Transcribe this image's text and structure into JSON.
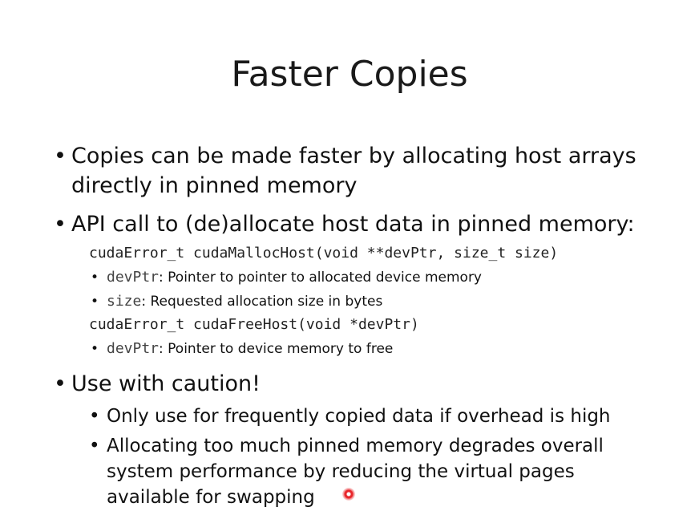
{
  "slide": {
    "title": "Faster Copies",
    "bullet_glyph": "•",
    "b1": {
      "line1": "Copies can be made faster by allocating host arrays",
      "line2": "directly in pinned memory"
    },
    "b2": {
      "text": "API call to (de)allocate host data in pinned memory:",
      "malloc_sig": "cudaError_t cudaMallocHost(void **devPtr, size_t size)",
      "malloc_params": [
        {
          "name": "devPtr",
          "desc": ": Pointer to pointer to allocated device memory"
        },
        {
          "name": "size",
          "desc": ": Requested allocation size in bytes"
        }
      ],
      "free_sig": "cudaError_t cudaFreeHost(void *devPtr)",
      "free_params": [
        {
          "name": "devPtr",
          "desc": ": Pointer to device memory to free"
        }
      ]
    },
    "b3": {
      "text": "Use with caution!",
      "sub1": "Only use for frequently copied data if overhead is high",
      "sub2_line1": "Allocating too much pinned memory degrades overall",
      "sub2_line2": "system performance by reducing the virtual pages",
      "sub2_line3": "available for swapping"
    }
  },
  "colors": {
    "text": "#111111",
    "code": "#222222",
    "pointer": "#e8262b"
  }
}
